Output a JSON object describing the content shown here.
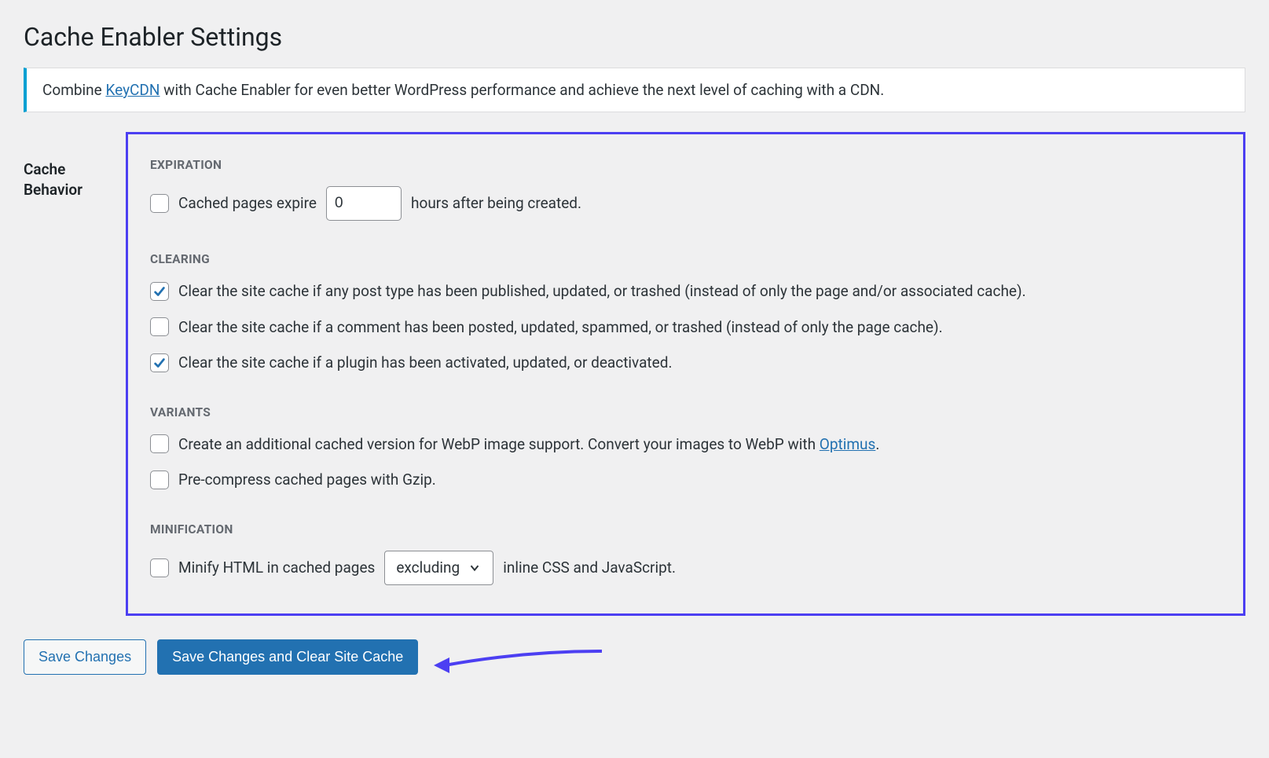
{
  "header": {
    "title": "Cache Enabler Settings"
  },
  "notice": {
    "prefix": "Combine ",
    "link_text": "KeyCDN",
    "suffix": " with Cache Enabler for even better WordPress performance and achieve the next level of caching with a CDN."
  },
  "section": {
    "label": "Cache Behavior"
  },
  "groups": {
    "expiration": {
      "heading": "EXPIRATION",
      "item": {
        "checked": false,
        "label_before": "Cached pages expire",
        "value": "0",
        "label_after": "hours after being created."
      }
    },
    "clearing": {
      "heading": "CLEARING",
      "items": [
        {
          "checked": true,
          "label": "Clear the site cache if any post type has been published, updated, or trashed (instead of only the page and/or associated cache)."
        },
        {
          "checked": false,
          "label": "Clear the site cache if a comment has been posted, updated, spammed, or trashed (instead of only the page cache)."
        },
        {
          "checked": true,
          "label": "Clear the site cache if a plugin has been activated, updated, or deactivated."
        }
      ]
    },
    "variants": {
      "heading": "VARIANTS",
      "webp": {
        "checked": false,
        "label_before": "Create an additional cached version for WebP image support. Convert your images to WebP with ",
        "link_text": "Optimus",
        "label_after": "."
      },
      "gzip": {
        "checked": false,
        "label": "Pre-compress cached pages with Gzip."
      }
    },
    "minification": {
      "heading": "MINIFICATION",
      "item": {
        "checked": false,
        "label_before": "Minify HTML in cached pages",
        "selected": "excluding",
        "label_after": "inline CSS and JavaScript."
      }
    }
  },
  "actions": {
    "save": "Save Changes",
    "save_clear": "Save Changes and Clear Site Cache"
  },
  "colors": {
    "highlight": "#4c3ff2",
    "primary": "#2271b1"
  }
}
